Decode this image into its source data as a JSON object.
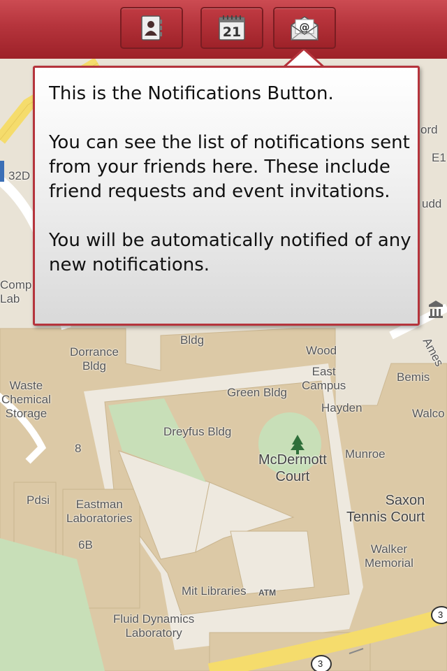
{
  "toolbar": {
    "contacts_icon": "contacts-book-icon",
    "calendar_icon": "calendar-icon",
    "calendar_day": "21",
    "notifications_icon": "envelope-at-icon",
    "colors": {
      "bar": "#b5343c",
      "button_border": "#7a1d22"
    }
  },
  "popup": {
    "text": "This is the Notifications Button.\n\nYou can see the list of notifications sent from your friends here. These include  friend requests and event invitations.\n\nYou will be automatically notified of any new notifications.",
    "border_color": "#b5343c"
  },
  "map": {
    "labels": {
      "dorrance": "Dorrance\nBldg",
      "bldg_top": "Bldg",
      "wood": "Wood",
      "east_campus": "East\nCampus",
      "green": "Green Bldg",
      "hayden": "Hayden",
      "bemis": "Bemis",
      "walco": "Walco",
      "waste": "Waste\nChemical\nStorage",
      "dreyfus": "Dreyfus Bldg",
      "mcdermott": "McDermott\nCourt",
      "munroe": "Munroe",
      "eight": "8",
      "pdsi": "Pdsi",
      "eastman": "Eastman\nLaboratories",
      "saxon": "Saxon\nTennis Court",
      "sixb": "6B",
      "walker": "Walker\nMemorial",
      "mit_libraries": "Mit Libraries",
      "atm": "ATM",
      "fluid": "Fluid Dynamics\nLaboratory",
      "ames": "Ames",
      "l32d": "32D",
      "comp": "Comp\nLab",
      "ord": "ord",
      "e1": "E1",
      "udd": "udd",
      "route3a": "3",
      "route3b": "3"
    }
  }
}
